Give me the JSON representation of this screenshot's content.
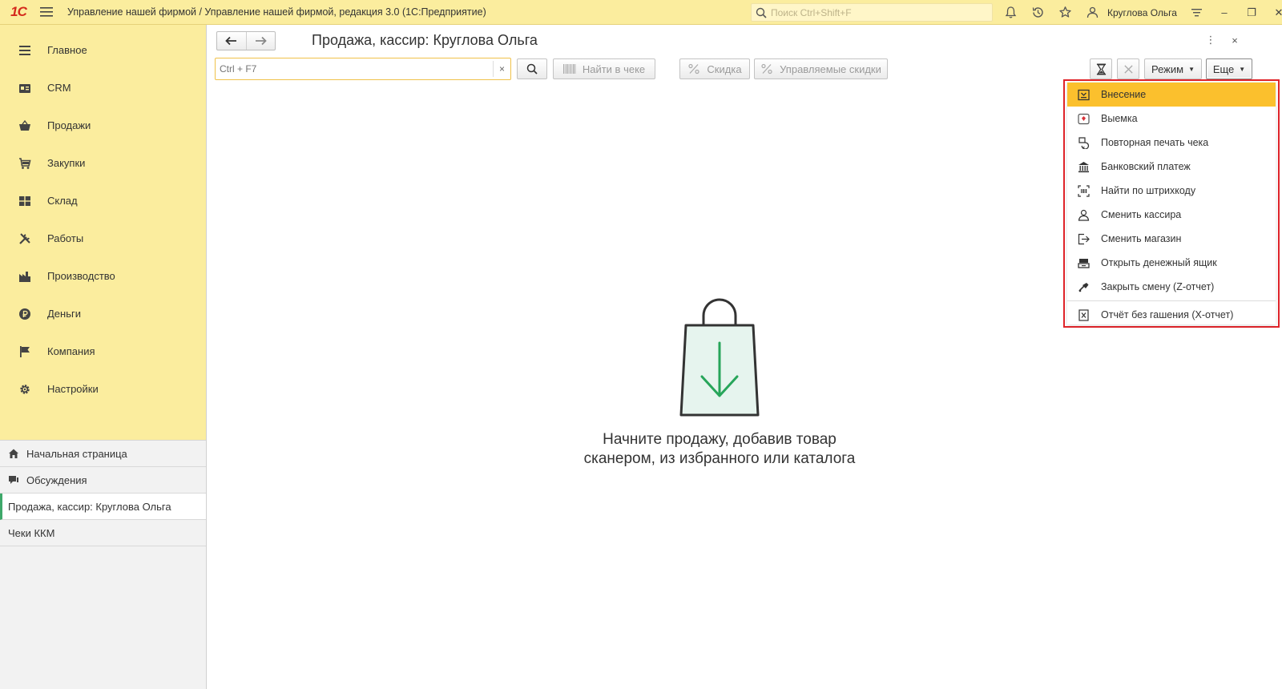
{
  "topbar": {
    "logo": "1С",
    "title": "Управление нашей фирмой / Управление нашей фирмой, редакция 3.0  (1С:Предприятие)",
    "search_placeholder": "Поиск Ctrl+Shift+F",
    "user": "Круглова Ольга",
    "icons": [
      "bell-icon",
      "history-icon",
      "star-icon",
      "user-icon",
      "settings-lines-icon"
    ],
    "window_controls": [
      "minimize",
      "restore",
      "close"
    ]
  },
  "sidebar": {
    "sections": [
      {
        "label": "Главное",
        "icon": "menu-lines-icon"
      },
      {
        "label": "CRM",
        "icon": "crm-card-icon"
      },
      {
        "label": "Продажи",
        "icon": "basket-icon"
      },
      {
        "label": "Закупки",
        "icon": "cart-icon"
      },
      {
        "label": "Склад",
        "icon": "warehouse-grid-icon"
      },
      {
        "label": "Работы",
        "icon": "tools-icon"
      },
      {
        "label": "Производство",
        "icon": "factory-icon"
      },
      {
        "label": "Деньги",
        "icon": "ruble-icon"
      },
      {
        "label": "Компания",
        "icon": "flag-icon"
      },
      {
        "label": "Настройки",
        "icon": "gear-icon"
      }
    ],
    "open_windows": [
      {
        "label": "Начальная страница",
        "icon": "home-icon"
      },
      {
        "label": "Обсуждения",
        "icon": "chat-icon"
      },
      {
        "label": "Продажа, кассир: Круглова Ольга",
        "active": true
      },
      {
        "label": "Чеки ККМ"
      }
    ]
  },
  "form": {
    "title": "Продажа, кассир: Круглова Ольга",
    "input_placeholder": "Ctrl + F7",
    "clear_label": "×",
    "find_in_check": "Найти в чеке",
    "discount": "Скидка",
    "managed_discounts": "Управляемые скидки",
    "mode": "Режим",
    "more": "Еще",
    "more_menu_symbol": "⋮",
    "close_symbol": "×"
  },
  "empty_state": {
    "line1": "Начните продажу, добавив товар",
    "line2": "сканером, из избранного или каталога"
  },
  "dropdown": {
    "items": [
      {
        "label": "Внесение",
        "icon": "deposit-icon",
        "highlighted": true
      },
      {
        "label": "Выемка",
        "icon": "withdrawal-icon"
      },
      {
        "label": "Повторная печать чека",
        "icon": "reprint-icon"
      },
      {
        "label": "Банковский платеж",
        "icon": "bank-icon"
      },
      {
        "label": "Найти по штрихкоду",
        "icon": "barcode-scan-icon"
      },
      {
        "label": "Сменить кассира",
        "icon": "person-icon"
      },
      {
        "label": "Сменить магазин",
        "icon": "exit-arrow-icon"
      },
      {
        "label": "Открыть денежный ящик",
        "icon": "cash-drawer-icon"
      },
      {
        "label": "Закрыть смену (Z-отчет)",
        "icon": "close-shift-icon"
      }
    ],
    "footer_item": {
      "label": "Отчёт без гашения (X-отчет)",
      "icon": "x-report-icon"
    }
  },
  "colors": {
    "panel_yellow": "#fbed9e",
    "highlight": "#fbc02d",
    "dropdown_border": "#e0242a",
    "active_marker": "#3ea86a",
    "bag_arrow": "#27a55a"
  }
}
